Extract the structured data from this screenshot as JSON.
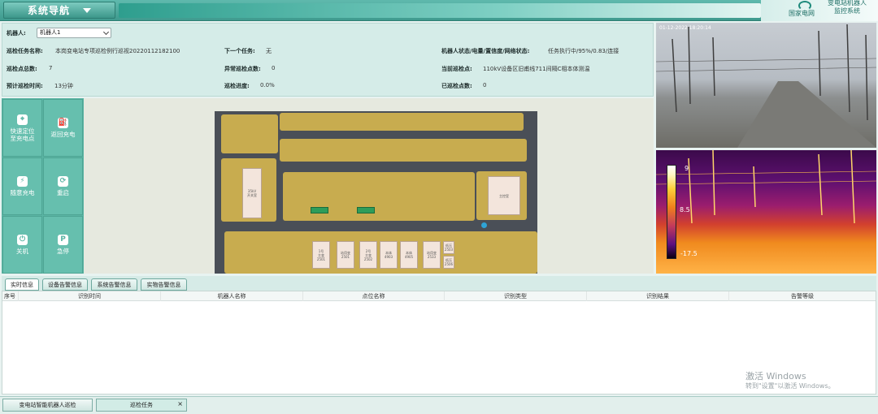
{
  "header": {
    "nav_label": "系统导航",
    "brand": "国家电网",
    "system_title_1": "变电站机器人",
    "system_title_2": "监控系统"
  },
  "info": {
    "robot_label": "机器人:",
    "robot_value": "机器人1",
    "task_name_label": "巡检任务名称:",
    "task_name_value": "本岗变电站专项巡检例行巡视20220112182100",
    "next_task_label": "下一个任务:",
    "next_task_value": "无",
    "status_label": "机器人状态/电量/置信度/网络状态:",
    "status_value": "任务执行中/95%/0.83/连接",
    "total_points_label": "巡检点总数:",
    "total_points_value": "7",
    "abnormal_label": "异常巡检点数:",
    "abnormal_value": "0",
    "current_point_label": "当前巡检点:",
    "current_point_value": "110kV设备区旧甫线711间隔C相本体测温",
    "est_time_label": "预计巡检时间:",
    "est_time_value": "13分钟",
    "progress_label": "巡检进度:",
    "progress_value": "0.0%",
    "done_label": "已巡检点数:",
    "done_value": "0"
  },
  "menu": [
    {
      "label": "快速定位\n至充电点",
      "icon": "charging-locate-icon",
      "glyph": "⌖"
    },
    {
      "label": "返回充电",
      "icon": "charger-icon",
      "glyph": "⛽"
    },
    {
      "label": "随意充电",
      "icon": "plug-icon",
      "glyph": "⚡"
    },
    {
      "label": "重启",
      "icon": "restart-icon",
      "glyph": "⟳"
    },
    {
      "label": "关机",
      "icon": "power-icon",
      "glyph": "⏻"
    },
    {
      "label": "急停",
      "icon": "emergency-stop-icon",
      "glyph": "P"
    }
  ],
  "map": {
    "main_transformer": "主控室",
    "ops_room": "35kV\n开关室",
    "tr1": "1号\n主变\n2501",
    "tr2": "2号\n主变\n2502",
    "tr_a": "本体\n4903",
    "tr_b": "本体\n4905",
    "sw1": "站用变\n2501",
    "sw2": "站用变2533",
    "cap1": "低压\n2503",
    "cap2": "低压\n2506"
  },
  "camera": {
    "timestamp": "01-12-2022 18:20:14",
    "thermal_max": "9",
    "thermal_mid": "8.5",
    "thermal_min": "-17.5",
    "colors": {
      "hot": "#ffb347",
      "cold": "#3b0a4a"
    }
  },
  "tabs": [
    "实时信息",
    "设备告警信息",
    "系统告警信息",
    "实物告警信息"
  ],
  "table": {
    "columns": [
      "序号",
      "识别时间",
      "机器人名称",
      "点位名称",
      "识别类型",
      "识别结果",
      "告警等级"
    ],
    "rows": []
  },
  "watermark": {
    "line1": "激活 Windows",
    "line2": "转到\"设置\"以激活 Windows。"
  },
  "bottom_tabs": [
    "变电站智能机器人巡检",
    "巡检任务"
  ],
  "bottom_close": "×"
}
